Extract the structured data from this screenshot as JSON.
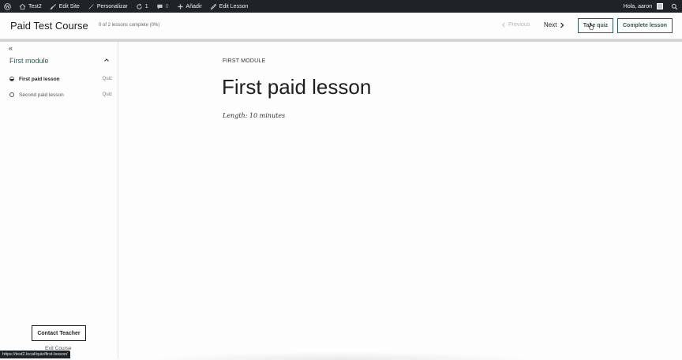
{
  "admin_bar": {
    "site_name": "Test2",
    "edit_site": "Edit Site",
    "customize": "Personalizar",
    "updates_count": "1",
    "comments_count": "0",
    "add_new": "Añadir",
    "edit_lesson": "Edit Lesson",
    "greeting": "Hola, aaron"
  },
  "header": {
    "course_title": "Paid Test Course",
    "progress_text": "0 of 2 lessons complete (0%)",
    "previous_label": "Previous",
    "next_label": "Next",
    "take_quiz_label": "Take quiz",
    "complete_lesson_label": "Complete lesson",
    "progress_percent": 0
  },
  "sidebar": {
    "collapse_glyph": "«",
    "module_title": "First module",
    "lessons": [
      {
        "label": "First paid lesson",
        "tag": "Quiz",
        "state": "in-progress"
      },
      {
        "label": "Second paid lesson",
        "tag": "Quiz",
        "state": "not-started"
      }
    ],
    "contact_teacher_label": "Contact Teacher",
    "exit_course_label": "Exit Course"
  },
  "main": {
    "breadcrumb": "FIRST MODULE",
    "lesson_title": "First paid lesson",
    "length_text": "Length: 10 minutes"
  },
  "status_bar": {
    "url": "https://test2.local/quiz/first-lesson/"
  },
  "icons": {
    "wp_logo": "wordpress-icon",
    "customize": "brush-icon",
    "updates": "refresh-icon",
    "comments": "comment-icon",
    "add": "plus-icon",
    "edit": "pencil-icon",
    "search": "search-icon"
  },
  "colors": {
    "accent": "#2b5d58",
    "admin_bar": "#1d2327"
  }
}
